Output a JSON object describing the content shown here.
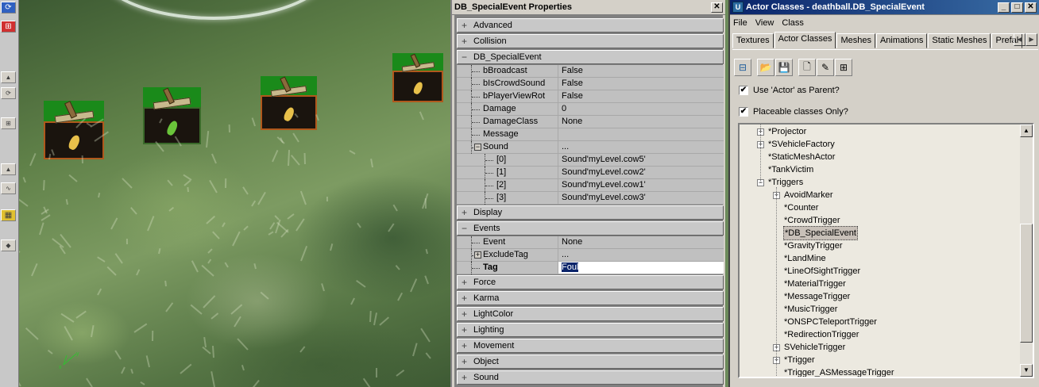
{
  "toolstrip": {
    "buttons": [
      "▲",
      "⟳",
      "⊞",
      "▲",
      "∿",
      "▦",
      "◆"
    ]
  },
  "properties_window": {
    "title": "DB_SpecialEvent Properties",
    "close_glyph": "✕",
    "categories": [
      {
        "expander": "+",
        "label": "Advanced"
      },
      {
        "expander": "+",
        "label": "Collision"
      },
      {
        "expander": "−",
        "label": "DB_SpecialEvent"
      },
      {
        "expander": "+",
        "label": "Display"
      },
      {
        "expander": "−",
        "label": "Events"
      },
      {
        "expander": "+",
        "label": "Force"
      },
      {
        "expander": "+",
        "label": "Karma"
      },
      {
        "expander": "+",
        "label": "LightColor"
      },
      {
        "expander": "+",
        "label": "Lighting"
      },
      {
        "expander": "+",
        "label": "Movement"
      },
      {
        "expander": "+",
        "label": "Object"
      },
      {
        "expander": "+",
        "label": "Sound"
      }
    ],
    "special_event_props": [
      {
        "key": "bBroadcast",
        "value": "False"
      },
      {
        "key": "bIsCrowdSound",
        "value": "False"
      },
      {
        "key": "bPlayerViewRot",
        "value": "False"
      },
      {
        "key": "Damage",
        "value": "0"
      },
      {
        "key": "DamageClass",
        "value": "None"
      },
      {
        "key": "Message",
        "value": ""
      },
      {
        "key": "Sound",
        "value": "..."
      },
      {
        "key": "[0]",
        "value": "Sound'myLevel.cow5'"
      },
      {
        "key": "[1]",
        "value": "Sound'myLevel.cow2'"
      },
      {
        "key": "[2]",
        "value": "Sound'myLevel.cow1'"
      },
      {
        "key": "[3]",
        "value": "Sound'myLevel.cow3'"
      }
    ],
    "events_props": [
      {
        "key": "Event",
        "value": "None"
      },
      {
        "key": "ExcludeTag",
        "value": "..."
      },
      {
        "key": "Tag",
        "value": "Foul"
      }
    ]
  },
  "actor_window": {
    "title": "Actor Classes - deathball.DB_SpecialEvent",
    "app_icon_glyph": "U",
    "window_buttons": [
      "_",
      "□",
      "✕"
    ],
    "menu": [
      "File",
      "View",
      "Class"
    ],
    "tabs": [
      "Textures",
      "Actor Classes",
      "Meshes",
      "Animations",
      "Static Meshes",
      "Prefal"
    ],
    "active_tab": "Actor Classes",
    "tab_scroll": [
      "◀",
      "▶"
    ],
    "toolbar": [
      "⊟",
      "📂",
      "💾",
      "🗋",
      "✎",
      "⊞"
    ],
    "checkbox_use_actor": {
      "label": "Use 'Actor' as Parent?",
      "checked": true,
      "mark": "✔"
    },
    "checkbox_placeable": {
      "label": "Placeable classes Only?",
      "checked": true,
      "mark": "✔"
    },
    "tree_items": [
      {
        "label": "*Projector",
        "expander": "+"
      },
      {
        "label": "*SVehicleFactory",
        "expander": "+"
      },
      {
        "label": "*StaticMeshActor",
        "expander": ""
      },
      {
        "label": "*TankVictim",
        "expander": ""
      },
      {
        "label": "*Triggers",
        "expander": "−"
      },
      {
        "label": "AvoidMarker",
        "expander": "+"
      },
      {
        "label": "*Counter",
        "expander": ""
      },
      {
        "label": "*CrowdTrigger",
        "expander": ""
      },
      {
        "label": "*DB_SpecialEvent",
        "expander": ""
      },
      {
        "label": "*GravityTrigger",
        "expander": ""
      },
      {
        "label": "*LandMine",
        "expander": ""
      },
      {
        "label": "*LineOfSightTrigger",
        "expander": ""
      },
      {
        "label": "*MaterialTrigger",
        "expander": ""
      },
      {
        "label": "*MessageTrigger",
        "expander": ""
      },
      {
        "label": "*MusicTrigger",
        "expander": ""
      },
      {
        "label": "*ONSPCTeleportTrigger",
        "expander": ""
      },
      {
        "label": "*RedirectionTrigger",
        "expander": ""
      },
      {
        "label": "SVehicleTrigger",
        "expander": "+"
      },
      {
        "label": "*Trigger",
        "expander": "+"
      },
      {
        "label": "*Trigger_ASMessageTrigger",
        "expander": ""
      }
    ],
    "selected_item": "*DB_SpecialEvent",
    "scroll_arrows": [
      "▲",
      "▼"
    ]
  },
  "colors": {
    "title_active": "#0a246a",
    "trigger_border_orange": "#b0581c",
    "trigger_green": "#1a8a1a"
  }
}
